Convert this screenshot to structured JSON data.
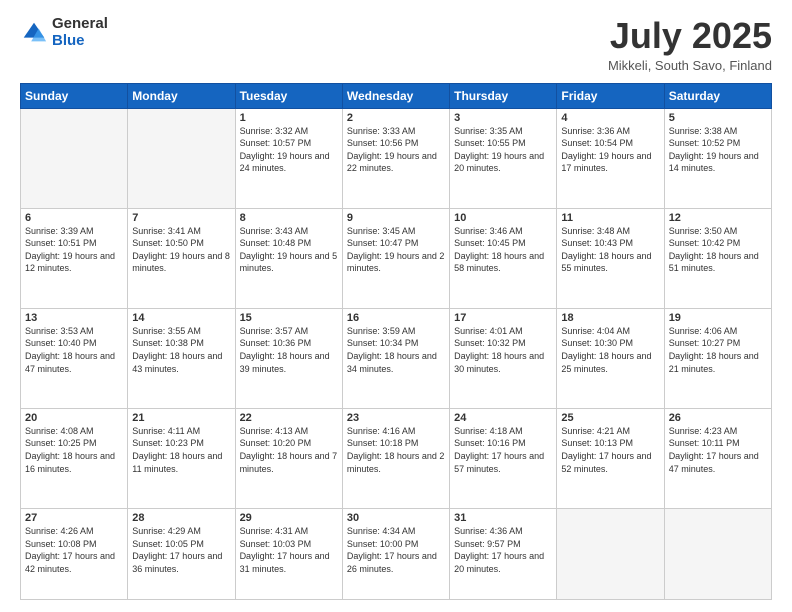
{
  "logo": {
    "general": "General",
    "blue": "Blue"
  },
  "header": {
    "month": "July 2025",
    "location": "Mikkeli, South Savo, Finland"
  },
  "days_of_week": [
    "Sunday",
    "Monday",
    "Tuesday",
    "Wednesday",
    "Thursday",
    "Friday",
    "Saturday"
  ],
  "weeks": [
    [
      {
        "day": "",
        "info": ""
      },
      {
        "day": "",
        "info": ""
      },
      {
        "day": "1",
        "info": "Sunrise: 3:32 AM\nSunset: 10:57 PM\nDaylight: 19 hours and 24 minutes."
      },
      {
        "day": "2",
        "info": "Sunrise: 3:33 AM\nSunset: 10:56 PM\nDaylight: 19 hours and 22 minutes."
      },
      {
        "day": "3",
        "info": "Sunrise: 3:35 AM\nSunset: 10:55 PM\nDaylight: 19 hours and 20 minutes."
      },
      {
        "day": "4",
        "info": "Sunrise: 3:36 AM\nSunset: 10:54 PM\nDaylight: 19 hours and 17 minutes."
      },
      {
        "day": "5",
        "info": "Sunrise: 3:38 AM\nSunset: 10:52 PM\nDaylight: 19 hours and 14 minutes."
      }
    ],
    [
      {
        "day": "6",
        "info": "Sunrise: 3:39 AM\nSunset: 10:51 PM\nDaylight: 19 hours and 12 minutes."
      },
      {
        "day": "7",
        "info": "Sunrise: 3:41 AM\nSunset: 10:50 PM\nDaylight: 19 hours and 8 minutes."
      },
      {
        "day": "8",
        "info": "Sunrise: 3:43 AM\nSunset: 10:48 PM\nDaylight: 19 hours and 5 minutes."
      },
      {
        "day": "9",
        "info": "Sunrise: 3:45 AM\nSunset: 10:47 PM\nDaylight: 19 hours and 2 minutes."
      },
      {
        "day": "10",
        "info": "Sunrise: 3:46 AM\nSunset: 10:45 PM\nDaylight: 18 hours and 58 minutes."
      },
      {
        "day": "11",
        "info": "Sunrise: 3:48 AM\nSunset: 10:43 PM\nDaylight: 18 hours and 55 minutes."
      },
      {
        "day": "12",
        "info": "Sunrise: 3:50 AM\nSunset: 10:42 PM\nDaylight: 18 hours and 51 minutes."
      }
    ],
    [
      {
        "day": "13",
        "info": "Sunrise: 3:53 AM\nSunset: 10:40 PM\nDaylight: 18 hours and 47 minutes."
      },
      {
        "day": "14",
        "info": "Sunrise: 3:55 AM\nSunset: 10:38 PM\nDaylight: 18 hours and 43 minutes."
      },
      {
        "day": "15",
        "info": "Sunrise: 3:57 AM\nSunset: 10:36 PM\nDaylight: 18 hours and 39 minutes."
      },
      {
        "day": "16",
        "info": "Sunrise: 3:59 AM\nSunset: 10:34 PM\nDaylight: 18 hours and 34 minutes."
      },
      {
        "day": "17",
        "info": "Sunrise: 4:01 AM\nSunset: 10:32 PM\nDaylight: 18 hours and 30 minutes."
      },
      {
        "day": "18",
        "info": "Sunrise: 4:04 AM\nSunset: 10:30 PM\nDaylight: 18 hours and 25 minutes."
      },
      {
        "day": "19",
        "info": "Sunrise: 4:06 AM\nSunset: 10:27 PM\nDaylight: 18 hours and 21 minutes."
      }
    ],
    [
      {
        "day": "20",
        "info": "Sunrise: 4:08 AM\nSunset: 10:25 PM\nDaylight: 18 hours and 16 minutes."
      },
      {
        "day": "21",
        "info": "Sunrise: 4:11 AM\nSunset: 10:23 PM\nDaylight: 18 hours and 11 minutes."
      },
      {
        "day": "22",
        "info": "Sunrise: 4:13 AM\nSunset: 10:20 PM\nDaylight: 18 hours and 7 minutes."
      },
      {
        "day": "23",
        "info": "Sunrise: 4:16 AM\nSunset: 10:18 PM\nDaylight: 18 hours and 2 minutes."
      },
      {
        "day": "24",
        "info": "Sunrise: 4:18 AM\nSunset: 10:16 PM\nDaylight: 17 hours and 57 minutes."
      },
      {
        "day": "25",
        "info": "Sunrise: 4:21 AM\nSunset: 10:13 PM\nDaylight: 17 hours and 52 minutes."
      },
      {
        "day": "26",
        "info": "Sunrise: 4:23 AM\nSunset: 10:11 PM\nDaylight: 17 hours and 47 minutes."
      }
    ],
    [
      {
        "day": "27",
        "info": "Sunrise: 4:26 AM\nSunset: 10:08 PM\nDaylight: 17 hours and 42 minutes."
      },
      {
        "day": "28",
        "info": "Sunrise: 4:29 AM\nSunset: 10:05 PM\nDaylight: 17 hours and 36 minutes."
      },
      {
        "day": "29",
        "info": "Sunrise: 4:31 AM\nSunset: 10:03 PM\nDaylight: 17 hours and 31 minutes."
      },
      {
        "day": "30",
        "info": "Sunrise: 4:34 AM\nSunset: 10:00 PM\nDaylight: 17 hours and 26 minutes."
      },
      {
        "day": "31",
        "info": "Sunrise: 4:36 AM\nSunset: 9:57 PM\nDaylight: 17 hours and 20 minutes."
      },
      {
        "day": "",
        "info": ""
      },
      {
        "day": "",
        "info": ""
      }
    ]
  ]
}
